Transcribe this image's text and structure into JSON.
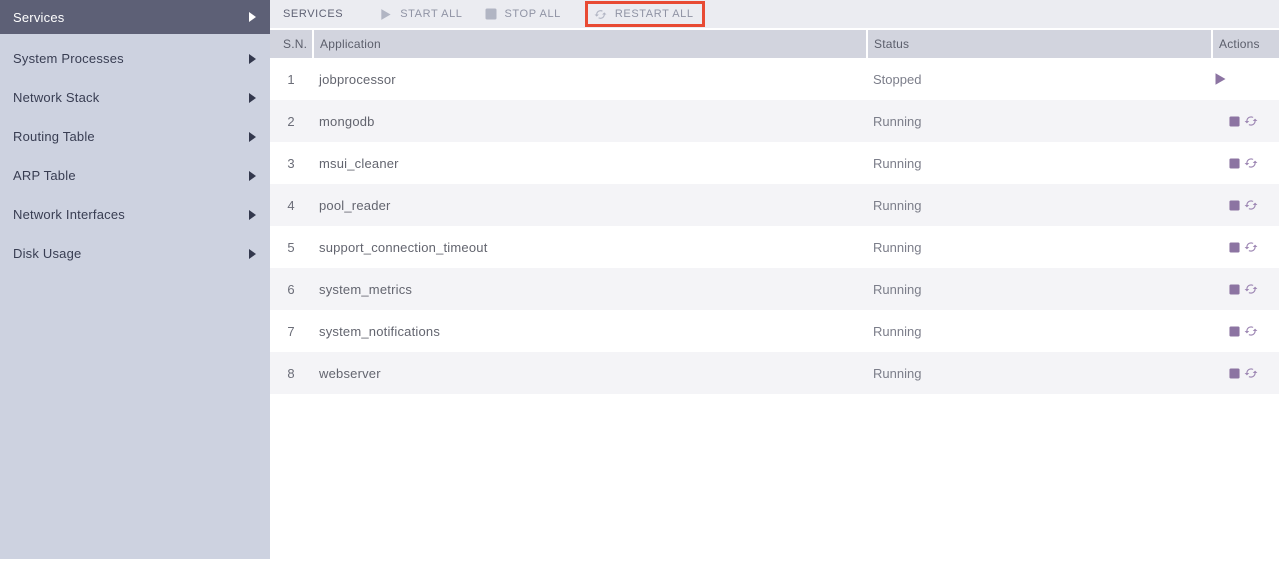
{
  "sidebar": {
    "items": [
      {
        "label": "Services",
        "selected": true
      },
      {
        "label": "System Processes",
        "selected": false
      },
      {
        "label": "Network Stack",
        "selected": false
      },
      {
        "label": "Routing Table",
        "selected": false
      },
      {
        "label": "ARP Table",
        "selected": false
      },
      {
        "label": "Network Interfaces",
        "selected": false
      },
      {
        "label": "Disk Usage",
        "selected": false
      }
    ]
  },
  "toolbar": {
    "title": "SERVICES",
    "start_all_label": "START ALL",
    "stop_all_label": "STOP ALL",
    "restart_all_label": "RESTART ALL"
  },
  "table": {
    "columns": [
      "S.N.",
      "Application",
      "Status",
      "Actions"
    ],
    "rows": [
      {
        "sn": "1",
        "application": "jobprocessor",
        "status": "Stopped",
        "actions": [
          "start"
        ]
      },
      {
        "sn": "2",
        "application": "mongodb",
        "status": "Running",
        "actions": [
          "stop",
          "restart"
        ]
      },
      {
        "sn": "3",
        "application": "msui_cleaner",
        "status": "Running",
        "actions": [
          "stop",
          "restart"
        ]
      },
      {
        "sn": "4",
        "application": "pool_reader",
        "status": "Running",
        "actions": [
          "stop",
          "restart"
        ]
      },
      {
        "sn": "5",
        "application": "support_connection_timeout",
        "status": "Running",
        "actions": [
          "stop",
          "restart"
        ]
      },
      {
        "sn": "6",
        "application": "system_metrics",
        "status": "Running",
        "actions": [
          "stop",
          "restart"
        ]
      },
      {
        "sn": "7",
        "application": "system_notifications",
        "status": "Running",
        "actions": [
          "stop",
          "restart"
        ]
      },
      {
        "sn": "8",
        "application": "webserver",
        "status": "Running",
        "actions": [
          "stop",
          "restart"
        ]
      }
    ]
  },
  "colors": {
    "sidebar-bg": "#cdd2e0",
    "sidebar-selected-bg": "#5d6076",
    "toolbar-bg": "#ebecf1",
    "header-bg": "#d2d4de",
    "row-alt-bg": "#f4f4f7",
    "action-purple": "#8c74a2",
    "action-purple-light": "#9e88b4",
    "highlight-red": "#e84a33"
  }
}
